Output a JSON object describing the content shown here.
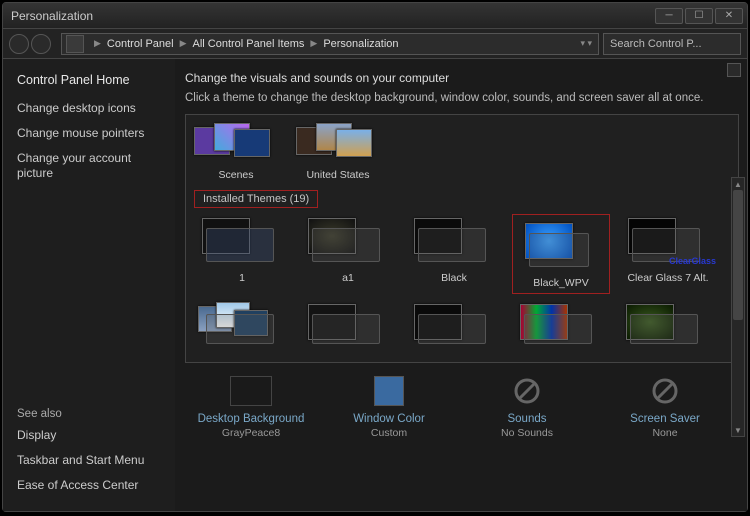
{
  "window_title": "Personalization",
  "breadcrumb": [
    "Control Panel",
    "All Control Panel Items",
    "Personalization"
  ],
  "search_placeholder": "Search Control P...",
  "sidebar": {
    "heading": "Control Panel Home",
    "links": [
      "Change desktop icons",
      "Change mouse pointers",
      "Change your account picture"
    ],
    "see_also_heading": "See also",
    "see_also": [
      "Display",
      "Taskbar and Start Menu",
      "Ease of Access Center"
    ]
  },
  "content": {
    "heading": "Change the visuals and sounds on your computer",
    "sub": "Click a theme to change the desktop background, window color, sounds, and screen saver all at once.",
    "top_themes": [
      "Scenes",
      "United States"
    ],
    "installed_label": "Installed Themes (19)",
    "installed_row1": [
      "1",
      "a1",
      "Black",
      "Black_WPV",
      "Clear Glass 7 Alt."
    ],
    "clearglass_logo": "ClearGlass",
    "bottom": [
      {
        "label": "Desktop Background",
        "value": "GrayPeace8"
      },
      {
        "label": "Window Color",
        "value": "Custom"
      },
      {
        "label": "Sounds",
        "value": "No Sounds"
      },
      {
        "label": "Screen Saver",
        "value": "None"
      }
    ]
  }
}
